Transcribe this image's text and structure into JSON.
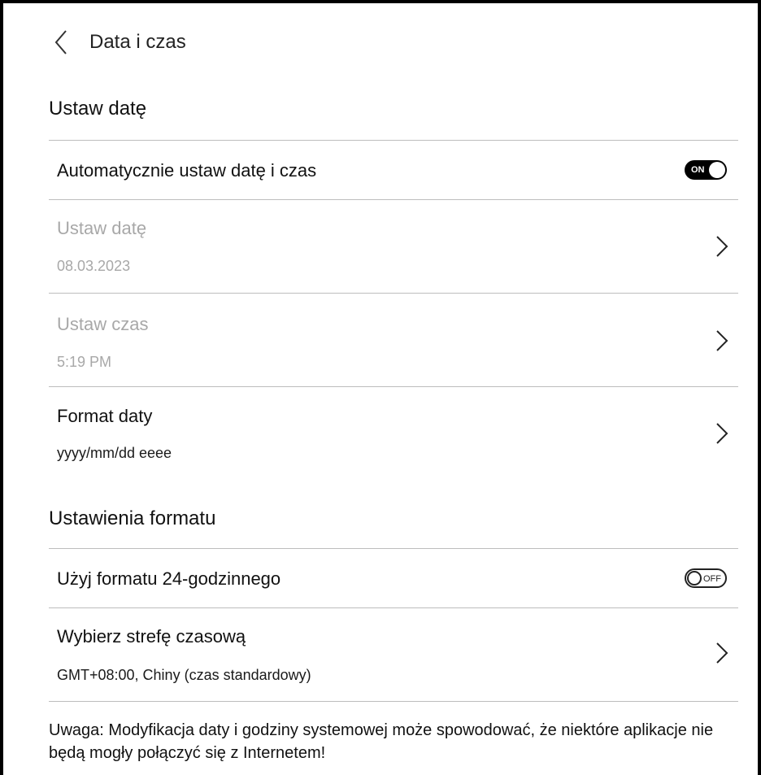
{
  "header": {
    "title": "Data i czas",
    "back_icon": "chevron-left-icon"
  },
  "section_date": {
    "title": "Ustaw datę"
  },
  "auto_datetime": {
    "label": "Automatycznie ustaw datę i czas",
    "toggle_text": "ON",
    "state": true
  },
  "set_date": {
    "label": "Ustaw datę",
    "value": "08.03.2023",
    "disabled": true
  },
  "set_time": {
    "label": "Ustaw czas",
    "value": "5:19 PM",
    "disabled": true
  },
  "date_format": {
    "label": "Format daty",
    "value": "yyyy/mm/dd eeee"
  },
  "section_format": {
    "title": "Ustawienia formatu"
  },
  "use_24h": {
    "label": "Użyj formatu 24-godzinnego",
    "toggle_text": "OFF",
    "state": false
  },
  "timezone": {
    "label": "Wybierz strefę czasową",
    "value": "GMT+08:00, Chiny (czas standardowy)"
  },
  "note": {
    "text": "Uwaga: Modyfikacja daty i godziny systemowej może spowodować, że niektóre aplikacje nie będą mogły połączyć się z Internetem!"
  },
  "colors": {
    "text": "#111111",
    "muted": "#a8a8a8",
    "divider": "#bdbdbd",
    "toggle_on": "#000000"
  }
}
